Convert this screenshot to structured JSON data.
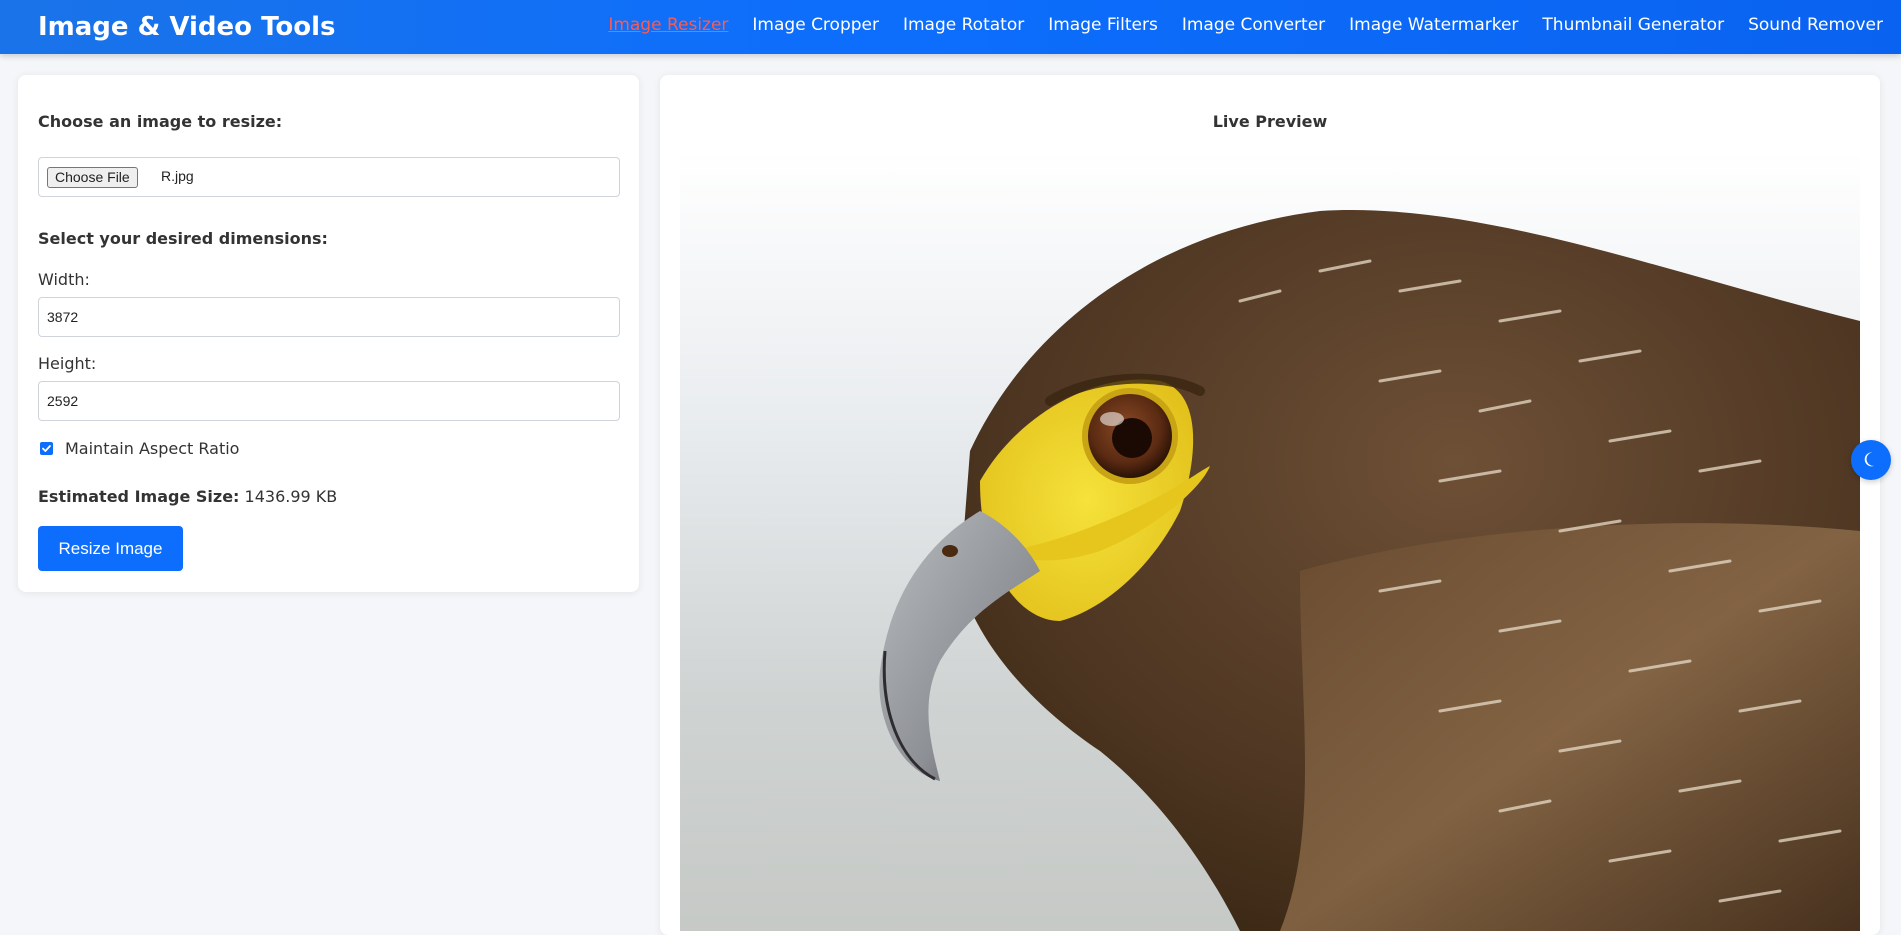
{
  "header": {
    "brand": "Image & Video Tools",
    "nav": [
      {
        "label": "Image Resizer",
        "active": true
      },
      {
        "label": "Image Cropper"
      },
      {
        "label": "Image Rotator"
      },
      {
        "label": "Image Filters"
      },
      {
        "label": "Image Converter"
      },
      {
        "label": "Image Watermarker"
      },
      {
        "label": "Thumbnail Generator"
      },
      {
        "label": "Sound Remover"
      }
    ]
  },
  "form": {
    "choose_label": "Choose an image to resize:",
    "file_button": "Choose File",
    "file_name": "R.jpg",
    "dimensions_label": "Select your desired dimensions:",
    "width_label": "Width:",
    "width_value": "3872",
    "height_label": "Height:",
    "height_value": "2592",
    "aspect_label": "Maintain Aspect Ratio",
    "aspect_checked": true,
    "estimate_label": "Estimated Image Size:",
    "estimate_value": "1436.99 KB",
    "resize_button": "Resize Image"
  },
  "preview": {
    "title": "Live Preview",
    "image_subject": "eagle-head-photo"
  },
  "theme_toggle": {
    "icon": "moon-icon"
  },
  "colors": {
    "primary": "#0d6efd",
    "active_nav": "#ff5a4e",
    "page_bg": "#f4f6f9"
  }
}
